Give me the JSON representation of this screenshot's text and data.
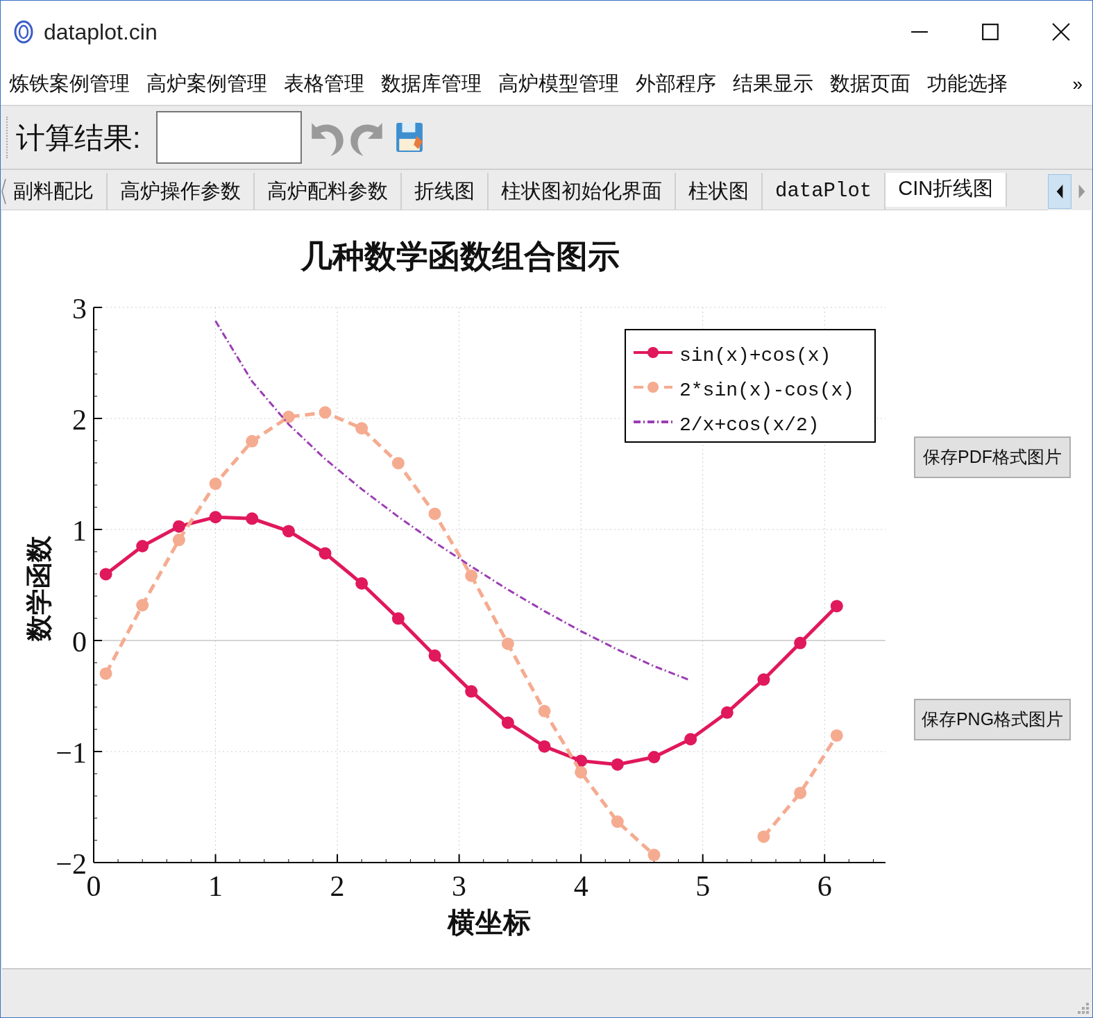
{
  "window": {
    "title": "dataplot.cin"
  },
  "menu": [
    "炼铁案例管理",
    "高炉案例管理",
    "表格管理",
    "数据库管理",
    "高炉模型管理",
    "外部程序",
    "结果显示",
    "数据页面",
    "功能选择"
  ],
  "menu_overflow": "»",
  "toolbar": {
    "label": "计算结果:",
    "undo": {
      "disabled": true
    },
    "redo": {
      "disabled": true
    }
  },
  "tabs": [
    {
      "label": "副料配比",
      "selected": false
    },
    {
      "label": "高炉操作参数",
      "selected": false
    },
    {
      "label": "高炉配料参数",
      "selected": false
    },
    {
      "label": "折线图",
      "selected": false
    },
    {
      "label": "柱状图初始化界面",
      "selected": false
    },
    {
      "label": "柱状图",
      "selected": false
    },
    {
      "label": "dataPlot",
      "selected": false
    },
    {
      "label": "CIN折线图",
      "selected": true
    }
  ],
  "chart_data": {
    "type": "line",
    "title": "几种数学函数组合图示",
    "xlabel": "横坐标",
    "ylabel": "数学函数",
    "x": [
      0.1,
      0.4,
      0.7,
      1.0,
      1.3,
      1.6,
      1.9,
      2.2,
      2.5,
      2.8,
      3.1,
      3.4,
      3.7,
      4.0,
      4.3,
      4.6,
      4.9,
      5.2,
      5.5,
      5.8,
      6.1
    ],
    "series": [
      {
        "name": "sin(x)+cos(x)",
        "color": "#e0185c",
        "line_style": "solid",
        "marker": "circle",
        "values": [
          0.597,
          0.85,
          1.027,
          1.111,
          1.098,
          0.985,
          0.785,
          0.514,
          0.198,
          -0.136,
          -0.458,
          -0.74,
          -0.954,
          -1.084,
          -1.117,
          -1.05,
          -0.889,
          -0.649,
          -0.352,
          -0.022,
          0.31
        ]
      },
      {
        "name": "2*sin(x)-cos(x)",
        "color": "#f5ab90",
        "line_style": "dashed",
        "marker": "circle",
        "values": [
          -0.298,
          0.318,
          0.906,
          1.412,
          1.795,
          2.014,
          2.054,
          1.911,
          1.597,
          1.141,
          0.583,
          -0.029,
          -0.636,
          -1.187,
          -1.632,
          -1.932,
          null,
          null,
          -1.767,
          -1.373,
          -0.856
        ]
      },
      {
        "name": "2/x+cos(x/2)",
        "color": "#9b3db3",
        "line_style": "dashdot",
        "marker": "none",
        "values": [
          null,
          null,
          null,
          2.878,
          2.334,
          1.947,
          1.635,
          1.363,
          1.115,
          0.884,
          0.666,
          0.459,
          0.265,
          0.084,
          -0.082,
          -0.231,
          -0.36,
          null,
          null,
          null,
          null
        ]
      }
    ],
    "xlim": [
      0,
      6.5
    ],
    "ylim": [
      -2,
      3
    ],
    "xticks": [
      0,
      1,
      2,
      3,
      4,
      5,
      6
    ],
    "yticks": [
      -2,
      -1,
      0,
      1,
      2,
      3
    ],
    "grid": true,
    "legend": true
  },
  "buttons": [
    "保存PDF格式图片",
    "保存PNG格式图片"
  ]
}
